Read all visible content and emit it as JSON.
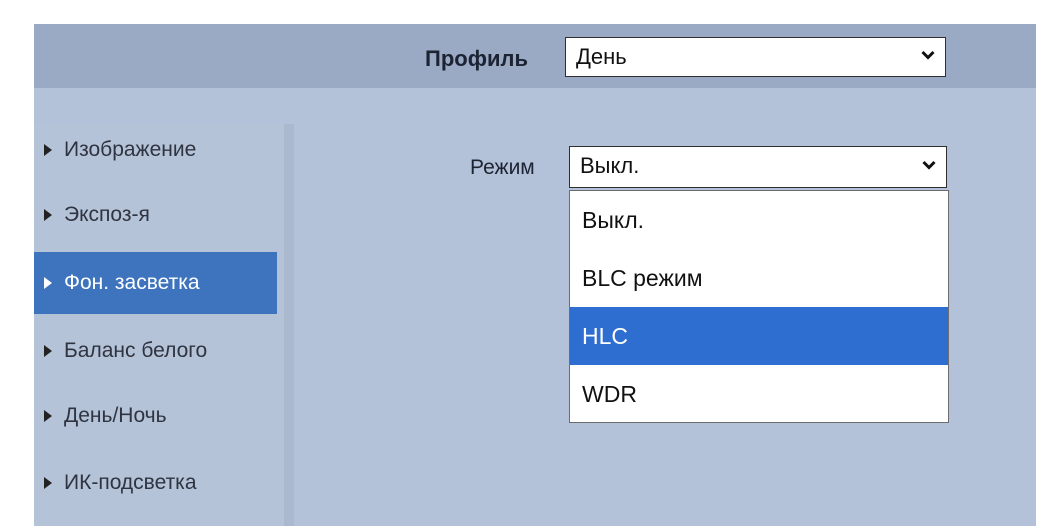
{
  "header": {
    "profile_label": "Профиль",
    "profile_value": "День"
  },
  "sidebar": {
    "items": [
      {
        "label": "Изображение",
        "active": false
      },
      {
        "label": "Экспоз-я",
        "active": false
      },
      {
        "label": "Фон. засветка",
        "active": true
      },
      {
        "label": "Баланс белого",
        "active": false
      },
      {
        "label": "День/Ночь",
        "active": false
      },
      {
        "label": "ИК-подсветка",
        "active": false
      }
    ]
  },
  "main": {
    "mode_label": "Режим",
    "mode_value": "Выкл.",
    "mode_options": [
      "Выкл.",
      "BLC режим",
      "HLC",
      "WDR"
    ],
    "highlighted_option": "HLC"
  },
  "colors": {
    "panel": "#b3c2d8",
    "topbar": "#9aaac4",
    "active_nav": "#3d74bd",
    "highlight": "#2f6ed1"
  },
  "icons": {
    "dropdown": "chevron-down-icon",
    "nav_bullet": "triangle-right-icon"
  }
}
